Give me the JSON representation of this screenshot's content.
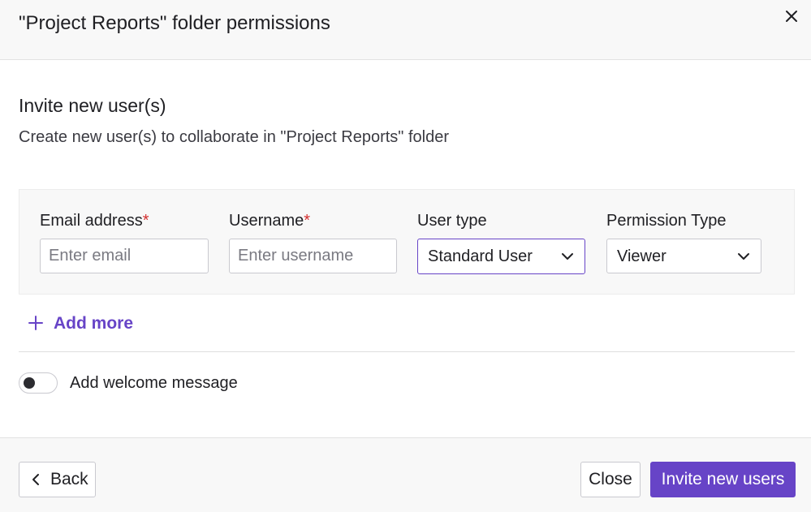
{
  "dialog": {
    "title": "\"Project Reports\" folder permissions",
    "close_icon": "close-icon"
  },
  "section": {
    "title": "Invite new user(s)",
    "subtitle": "Create new user(s) to collaborate in \"Project Reports\" folder"
  },
  "form": {
    "email": {
      "label": "Email address",
      "required_mark": "*",
      "value": "",
      "placeholder": "Enter email"
    },
    "username": {
      "label": "Username",
      "required_mark": "*",
      "value": "",
      "placeholder": "Enter username"
    },
    "user_type": {
      "label": "User type",
      "selected": "Standard User",
      "icon": "chevron-down-icon"
    },
    "permission_type": {
      "label": "Permission Type",
      "selected": "Viewer",
      "icon": "chevron-down-icon"
    }
  },
  "add_more": {
    "label": "Add more",
    "icon": "plus-icon"
  },
  "welcome": {
    "label": "Add welcome message",
    "enabled": false
  },
  "footer": {
    "back_label": "Back",
    "back_icon": "chevron-left-icon",
    "close_label": "Close",
    "invite_label": "Invite new users"
  },
  "colors": {
    "accent": "#6744c7",
    "required": "#d32f2f",
    "panel_bg": "#f8f8f8"
  }
}
